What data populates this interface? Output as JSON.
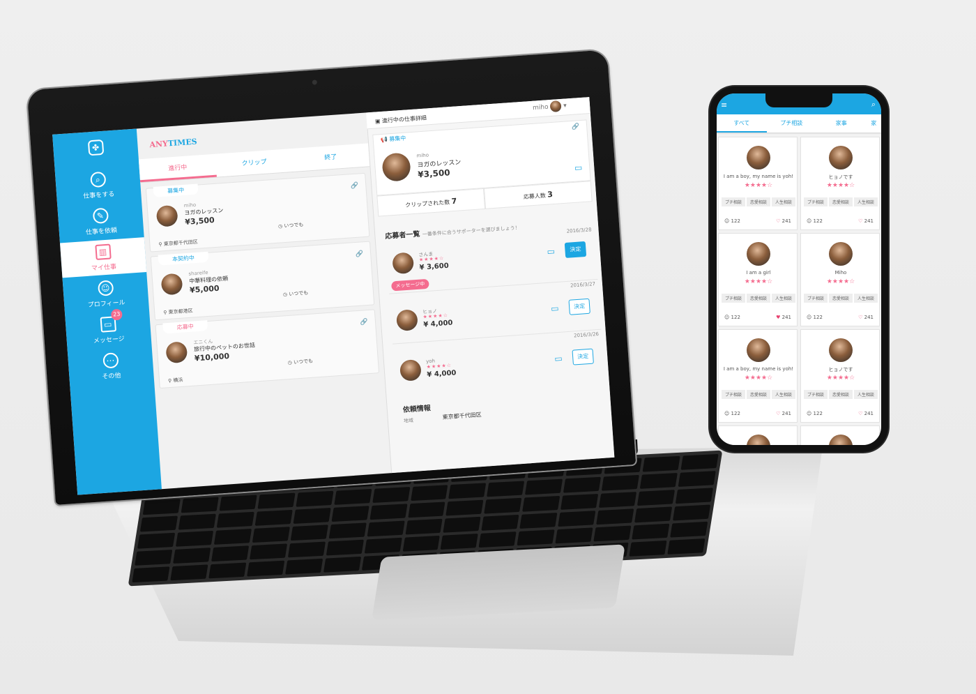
{
  "app": {
    "brand_a": "ANY",
    "brand_b": "TIMES",
    "user": "miho"
  },
  "sidebar": {
    "items": [
      {
        "label": "仕事をする",
        "icon": "search-icon"
      },
      {
        "label": "仕事を依頼",
        "icon": "pencil-icon"
      },
      {
        "label": "マイ仕事",
        "icon": "book-icon"
      },
      {
        "label": "プロフィール",
        "icon": "person-icon"
      },
      {
        "label": "メッセージ",
        "icon": "chat-icon",
        "badge": "23"
      },
      {
        "label": "その他",
        "icon": "more-icon"
      }
    ]
  },
  "tabs": [
    "進行中",
    "クリップ",
    "終了"
  ],
  "jobs": [
    {
      "status": "募集中",
      "user": "miho",
      "title": "ヨガのレッスン",
      "price": "¥3,500",
      "location": "東京都千代田区",
      "when": "いつでも"
    },
    {
      "status": "本契約中",
      "user": "shareife",
      "title": "中華料理の依頼",
      "price": "¥5,000",
      "location": "東京都港区",
      "when": "いつでも"
    },
    {
      "status": "応募中",
      "user": "エニくん",
      "title": "旅行中のペットのお世話",
      "price": "¥10,000",
      "location": "横浜",
      "when": "いつでも"
    }
  ],
  "detail": {
    "header": "進行中の仕事詳細",
    "status": "募集中",
    "user": "miho",
    "title": "ヨガのレッスン",
    "price": "¥3,500",
    "clips_label": "クリップされた数",
    "clips": "7",
    "applicants_label": "応募人数",
    "applicants": "3",
    "list_title": "応募者一覧",
    "list_sub": "一番条件に合うサポーターを選びましょう！",
    "applicants_list": [
      {
        "date": "2016/3/28",
        "name": "さんま",
        "price": "¥ 3,600",
        "action": "決定",
        "pill": "メッセージ中"
      },
      {
        "date": "2016/3/27",
        "name": "ヒョノ",
        "price": "¥ 4,000",
        "action": "決定"
      },
      {
        "date": "2016/3/26",
        "name": "yoh",
        "price": "¥ 4,000",
        "action": "決定"
      }
    ],
    "request_info": "依頼情報",
    "area_label": "地域",
    "area_value": "東京都千代田区"
  },
  "phone": {
    "tabs": [
      "すべて",
      "プチ相談",
      "家事",
      "家"
    ],
    "cards": [
      {
        "name": "I am a boy, my name is yoh!",
        "stars": "★★★★☆",
        "tags": [
          "プチ相談",
          "恋愛相談",
          "人生相談"
        ],
        "c1": "122",
        "c2": "241",
        "liked": false
      },
      {
        "name": "ヒョノです",
        "stars": "★★★★☆",
        "tags": [
          "プチ相談",
          "恋愛相談",
          "人生相談"
        ],
        "c1": "122",
        "c2": "241",
        "liked": false
      },
      {
        "name": "I am a girl",
        "stars": "★★★★☆",
        "tags": [
          "プチ相談",
          "恋愛相談",
          "人生相談"
        ],
        "c1": "122",
        "c2": "241",
        "liked": true
      },
      {
        "name": "Miho",
        "stars": "★★★★☆",
        "tags": [
          "プチ相談",
          "恋愛相談",
          "人生相談"
        ],
        "c1": "122",
        "c2": "241",
        "liked": false
      },
      {
        "name": "I am a boy, my name is yoh!",
        "stars": "★★★★☆",
        "tags": [
          "プチ相談",
          "恋愛相談",
          "人生相談"
        ],
        "c1": "122",
        "c2": "241",
        "liked": false
      },
      {
        "name": "ヒョノです",
        "stars": "★★★★☆",
        "tags": [
          "プチ相談",
          "恋愛相談",
          "人生相談"
        ],
        "c1": "122",
        "c2": "241",
        "liked": false
      }
    ]
  },
  "colors": {
    "accent": "#1ca6e2",
    "pink": "#f46c8f"
  }
}
